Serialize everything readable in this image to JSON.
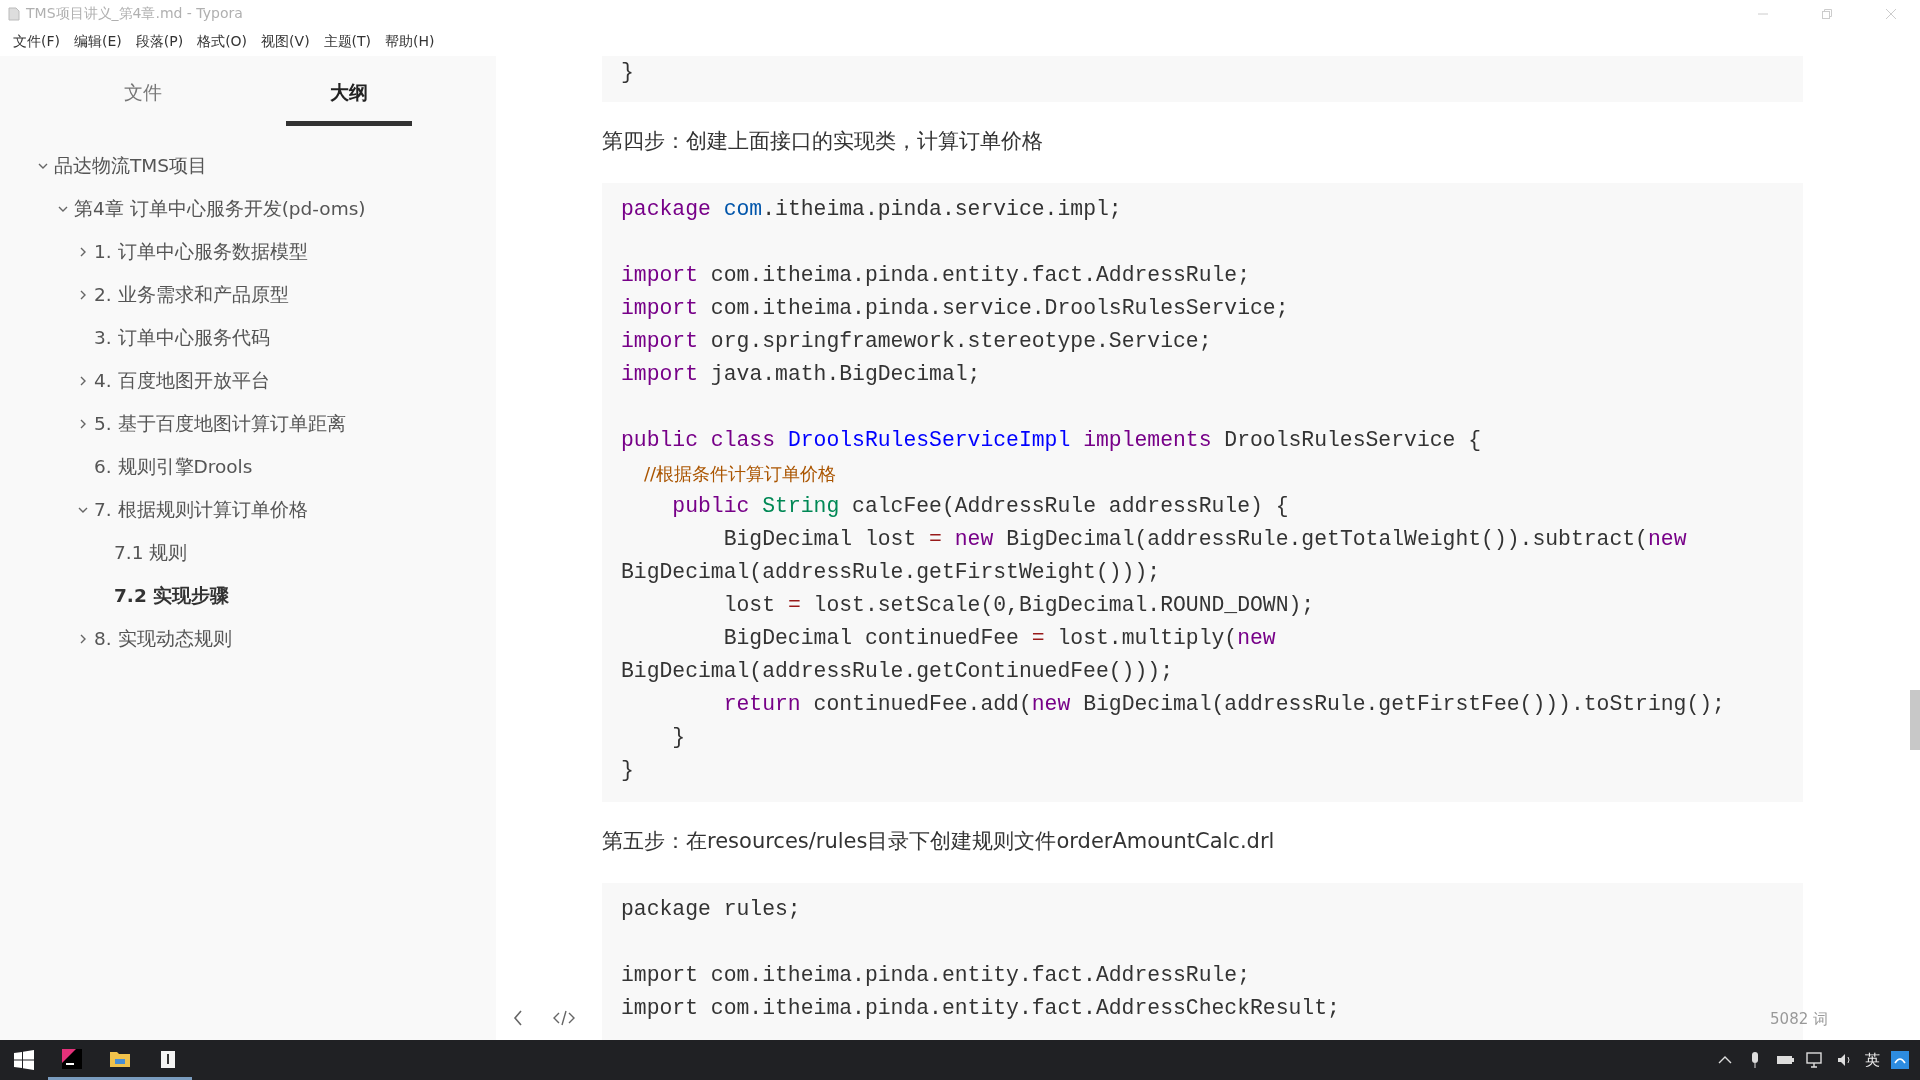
{
  "window": {
    "title": "TMS项目讲义_第4章.md - Typora"
  },
  "menu": [
    "文件(F)",
    "编辑(E)",
    "段落(P)",
    "格式(O)",
    "视图(V)",
    "主题(T)",
    "帮助(H)"
  ],
  "sidebar": {
    "tabs": [
      {
        "label": "文件",
        "selected": false
      },
      {
        "label": "大纲",
        "selected": true
      }
    ],
    "outline": [
      {
        "label": "品达物流TMS项目",
        "kind": "branch",
        "expanded": true,
        "selected": false,
        "children": [
          {
            "label": "第4章 订单中心服务开发(pd-oms)",
            "kind": "branch",
            "expanded": true,
            "selected": false,
            "children": [
              {
                "label": "1. 订单中心服务数据模型",
                "kind": "branch",
                "expanded": false,
                "selected": false
              },
              {
                "label": "2. 业务需求和产品原型",
                "kind": "branch",
                "expanded": false,
                "selected": false
              },
              {
                "label": "3. 订单中心服务代码",
                "kind": "leaf",
                "selected": false
              },
              {
                "label": "4. 百度地图开放平台",
                "kind": "branch",
                "expanded": false,
                "selected": false
              },
              {
                "label": "5. 基于百度地图计算订单距离",
                "kind": "branch",
                "expanded": false,
                "selected": false
              },
              {
                "label": "6. 规则引擎Drools",
                "kind": "leaf",
                "selected": false
              },
              {
                "label": "7. 根据规则计算订单价格",
                "kind": "branch",
                "expanded": true,
                "selected": false,
                "children": [
                  {
                    "label": "7.1 规则",
                    "kind": "leaf",
                    "selected": false
                  },
                  {
                    "label": "7.2 实现步骤",
                    "kind": "leaf",
                    "selected": true
                  }
                ]
              },
              {
                "label": "8. 实现动态规则",
                "kind": "branch",
                "expanded": false,
                "selected": false
              }
            ]
          }
        ]
      }
    ]
  },
  "document": [
    {
      "kind": "code",
      "groups": [
        [
          [
            {
              "kind": "plain",
              "text": "}"
            }
          ]
        ]
      ]
    },
    {
      "kind": "paragraph",
      "text": "第四步：创建上面接口的实现类，计算订单价格"
    },
    {
      "kind": "code",
      "groups": [
        [
          [
            {
              "kind": "keyword",
              "text": "package"
            },
            {
              "kind": "namespace",
              "text": " com"
            },
            {
              "kind": "plain",
              "text": ".itheima.pinda.service.impl;"
            }
          ]
        ],
        [
          [
            {
              "kind": "keyword",
              "text": "import"
            },
            {
              "kind": "plain",
              "text": " com.itheima.pinda.entity.fact.AddressRule;"
            }
          ],
          [
            {
              "kind": "keyword",
              "text": "import"
            },
            {
              "kind": "plain",
              "text": " com.itheima.pinda.service.DroolsRulesService;"
            }
          ],
          [
            {
              "kind": "keyword",
              "text": "import"
            },
            {
              "kind": "plain",
              "text": " org.springframework.stereotype.Service;"
            }
          ],
          [
            {
              "kind": "keyword",
              "text": "import"
            },
            {
              "kind": "plain",
              "text": " java.math.BigDecimal;"
            }
          ]
        ],
        [
          [
            {
              "kind": "keyword",
              "text": "public class"
            },
            {
              "kind": "def",
              "text": " DroolsRulesServiceImpl"
            },
            {
              "kind": "keyword",
              "text": " implements"
            },
            {
              "kind": "plain",
              "text": " DroolsRulesService {"
            }
          ],
          [
            {
              "kind": "comment",
              "text": "    //根据条件计算订单价格"
            }
          ],
          [
            {
              "kind": "keyword",
              "text": "    public"
            },
            {
              "kind": "type",
              "text": " String"
            },
            {
              "kind": "plain",
              "text": " calcFee(AddressRule addressRule) {"
            }
          ],
          [
            {
              "kind": "plain",
              "text": "        BigDecimal lost"
            },
            {
              "kind": "operator",
              "text": " ="
            },
            {
              "kind": "keyword",
              "text": " new"
            },
            {
              "kind": "plain",
              "text": " BigDecimal(addressRule.getTotalWeight()).subtract("
            },
            {
              "kind": "keyword",
              "text": "new"
            }
          ],
          [
            {
              "kind": "plain",
              "text": "BigDecimal(addressRule.getFirstWeight()));"
            }
          ],
          [
            {
              "kind": "plain",
              "text": "        lost"
            },
            {
              "kind": "operator",
              "text": " ="
            },
            {
              "kind": "plain",
              "text": " lost.setScale(0,BigDecimal.ROUND_DOWN);"
            }
          ],
          [
            {
              "kind": "plain",
              "text": "        BigDecimal continuedFee"
            },
            {
              "kind": "operator",
              "text": " ="
            },
            {
              "kind": "plain",
              "text": " lost.multiply("
            },
            {
              "kind": "keyword",
              "text": "new"
            }
          ],
          [
            {
              "kind": "plain",
              "text": "BigDecimal(addressRule.getContinuedFee()));"
            }
          ],
          [
            {
              "kind": "keyword",
              "text": "        return"
            },
            {
              "kind": "plain",
              "text": " continuedFee.add("
            },
            {
              "kind": "keyword",
              "text": "new"
            },
            {
              "kind": "plain",
              "text": " BigDecimal(addressRule.getFirstFee())).toString();"
            }
          ],
          [
            {
              "kind": "plain",
              "text": "    }"
            }
          ],
          [
            {
              "kind": "plain",
              "text": "}"
            }
          ]
        ]
      ]
    },
    {
      "kind": "paragraph",
      "text": "第五步：在resources/rules目录下创建规则文件orderAmountCalc.drl"
    },
    {
      "kind": "code",
      "groups": [
        [
          [
            {
              "kind": "plain",
              "text": "package rules;"
            }
          ]
        ],
        [
          [
            {
              "kind": "plain",
              "text": "import com.itheima.pinda.entity.fact.AddressRule;"
            }
          ],
          [
            {
              "kind": "plain",
              "text": "import com.itheima.pinda.entity.fact.AddressCheckResult;"
            }
          ]
        ]
      ]
    }
  ],
  "status_bar": {
    "word_count": "5082 词"
  },
  "taskbar": {
    "tray_language": "英"
  }
}
